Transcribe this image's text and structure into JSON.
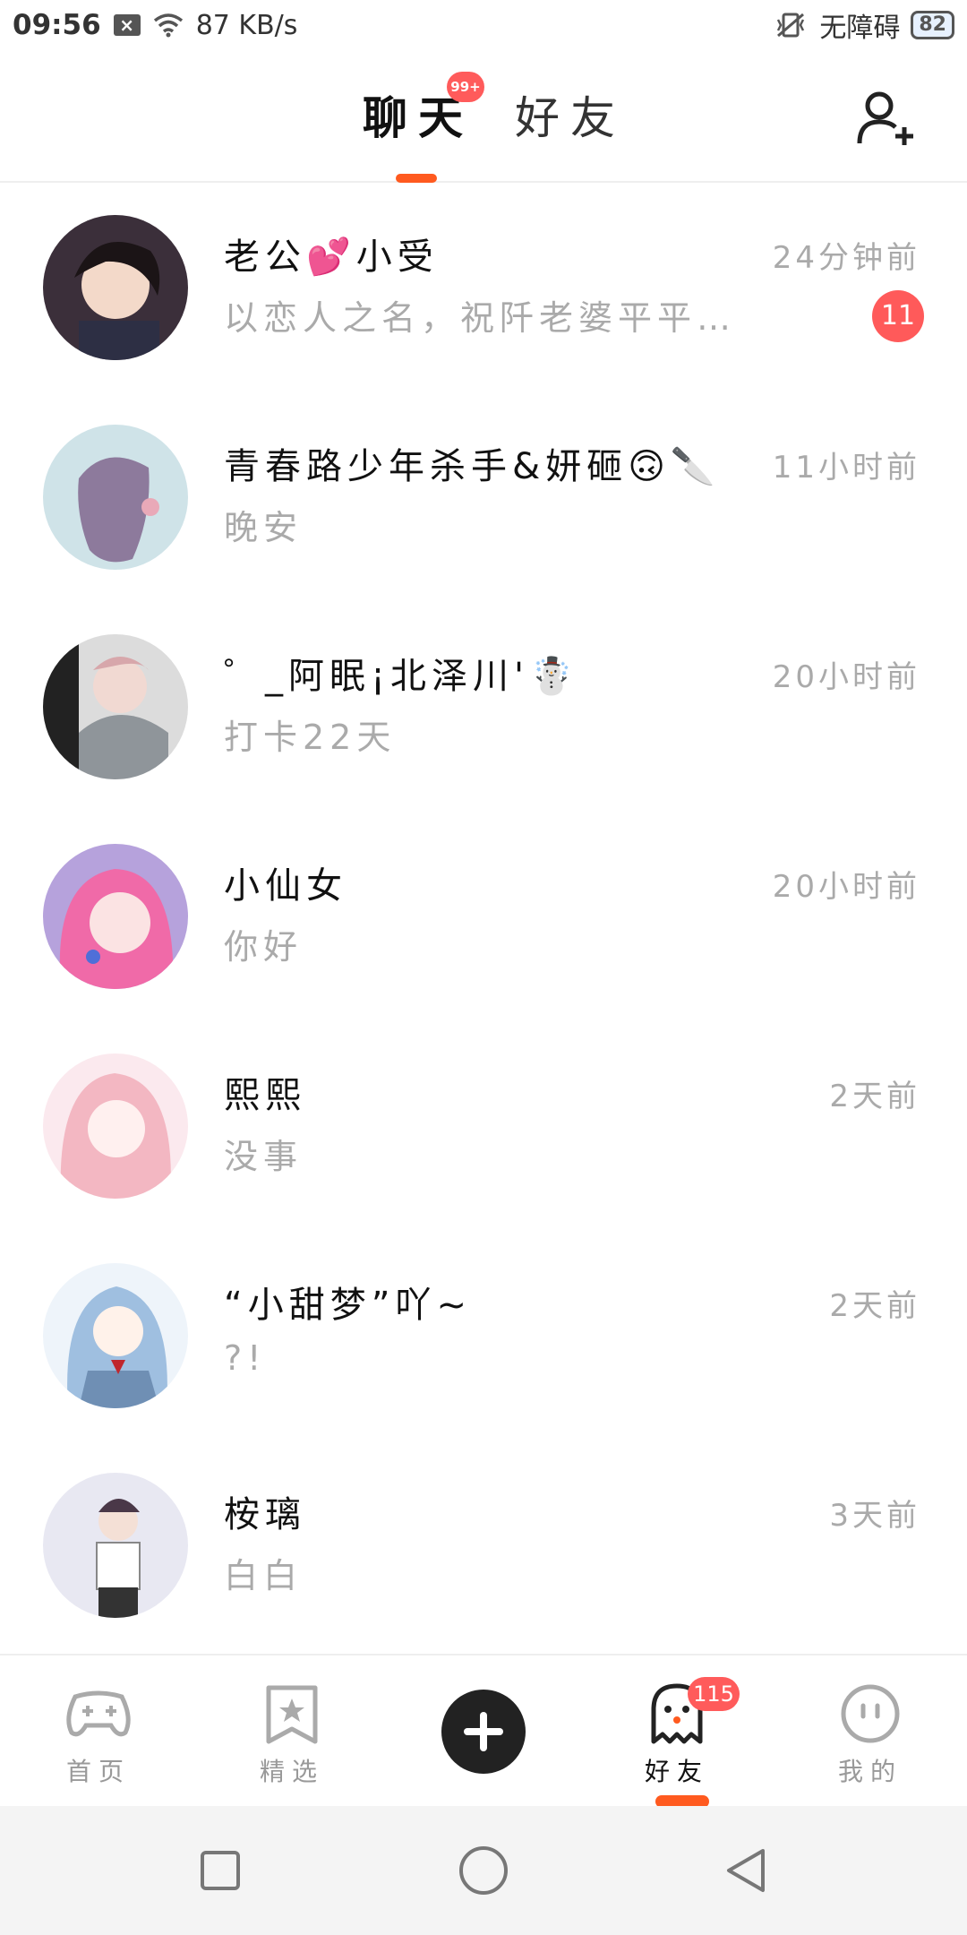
{
  "status_bar": {
    "time": "09:56",
    "net_speed": "87 KB/s",
    "accessibility": "无障碍",
    "battery": "82"
  },
  "header": {
    "tabs": [
      {
        "label": "聊天",
        "badge": "99+"
      },
      {
        "label": "好友"
      }
    ]
  },
  "chats": [
    {
      "name": "老公💕小受",
      "message": "以恋人之名，祝阡老婆平平…",
      "time": "24分钟前",
      "unread": "11"
    },
    {
      "name": "青春路少年杀手&妍砸🙃🔪",
      "message": "晚安",
      "time": "11小时前"
    },
    {
      "name": "゜_阿眠¡北泽川'☃️",
      "message": "打卡22天",
      "time": "20小时前"
    },
    {
      "name": "小仙女",
      "message": "你好",
      "time": "20小时前"
    },
    {
      "name": "熙熙",
      "message": "没事",
      "time": "2天前"
    },
    {
      "name": "“小甜梦”吖~",
      "message": "?!",
      "time": "2天前"
    },
    {
      "name": "桉璃",
      "message": "白白",
      "time": "3天前"
    }
  ],
  "bottom_nav": {
    "items": [
      {
        "label": "首页",
        "icon": "gamepad-icon"
      },
      {
        "label": "精选",
        "icon": "bookmark-star-icon"
      },
      {
        "label": "",
        "icon": "plus-icon"
      },
      {
        "label": "好友",
        "icon": "ghost-icon",
        "badge": "115"
      },
      {
        "label": "我的",
        "icon": "smiley-icon"
      }
    ]
  },
  "colors": {
    "accent": "#ff5a1f",
    "badge": "#ff5b5b",
    "muted_text": "#aaaaaa"
  }
}
